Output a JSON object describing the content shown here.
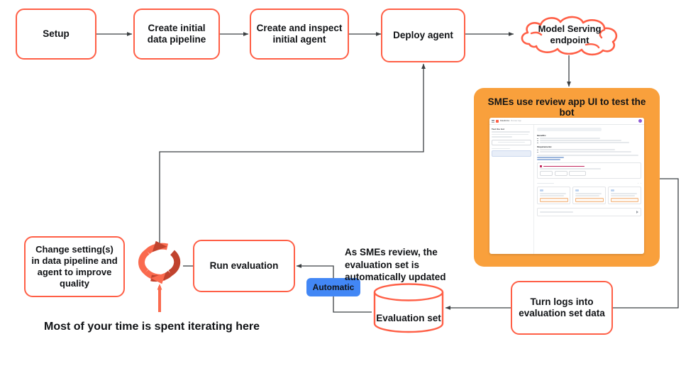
{
  "theme": {
    "accent_red": "#FF5F46",
    "panel_orange": "#F9A03C",
    "badge_blue": "#4287F5",
    "loop_dark": "#C0432E",
    "loop_light": "#FA6A4E",
    "wire_gray": "#3C4043",
    "text_dark": "#111316"
  },
  "flow": {
    "setup": "Setup",
    "create_pipeline": "Create initial\ndata pipeline",
    "create_agent": "Create and inspect\ninitial agent",
    "deploy_agent": "Deploy agent",
    "model_serving": "Model Serving\nendpoint",
    "change_settings": "Change setting(s)\nin data pipeline and\nagent to improve\nquality",
    "run_evaluation": "Run evaluation",
    "evaluation_set": "Evaluation set",
    "turn_logs": "Turn logs into\nevaluation set data",
    "automatic_badge": "Automatic",
    "sme_note": "As SMEs review, the\nevaluation set is\nautomatically updated",
    "iterate_caption": "Most of your time is spent iterating here"
  },
  "panel": {
    "title": "SMEs use review app UI to test the bot",
    "screenshot": {
      "topbar": {
        "menu_icon": "hamburger-icon",
        "logo_icon": "databricks-logo-icon",
        "app_name": "Databricks",
        "app_subtitle": "Review App",
        "avatar_icon": "user-avatar-icon"
      },
      "sidebar": {
        "heading": "Test the bot",
        "description": "Ask your own questions to evaluate the bot's responses and then provide feedback.",
        "new_chat_button": "Start a new chat",
        "history_label": "October 2024",
        "history_item": "what is lakehouse monitoring?..."
      },
      "main": {
        "query_pill": "retail-prod_agents_ds_docs_new_model_1",
        "section_1_heading": "Benefits:",
        "section_1_bullets": [
          "Ensures data integrity and quality",
          "Helps in detecting data drift and troubleshooting issues",
          "Provides insights into data distribution changes and model input shifts"
        ],
        "section_2_heading": "Requirements:",
        "section_2_bullets": [
          "Requires Unity Catalog and access to Databricks SQL",
          "Support for Delta tables, including managed, external, views, and streaming tables"
        ],
        "footnote": "Lakehouse Monitoring is currently in Public Preview and uses serverless compute for workflows.",
        "link_sources": "Click to generate",
        "link_edit": "Edit response",
        "feedback": {
          "heading": "Awaiting feedback",
          "question": "Is this a good response for the question?",
          "buttons": [
            "Yes",
            "No",
            "I don't know"
          ]
        },
        "sources_label": "Sources",
        "source_cards": [
          {
            "title": "/Volumes/dev_agents_ui/docs_data/databricks_docs/lakehouse-...",
            "ref": "1 reference"
          },
          {
            "title": "/Volumes/dev_agents_ui/docs_data/databricks_docs/lakehouse-...",
            "ref": "1 reference"
          },
          {
            "title": "/Volumes/dev_agents_ui/docs_data/databricks_docs/lakehouse-...",
            "ref": "1 reference"
          }
        ],
        "ask_placeholder": "Ask your question",
        "send_icon": "send-icon"
      }
    }
  }
}
